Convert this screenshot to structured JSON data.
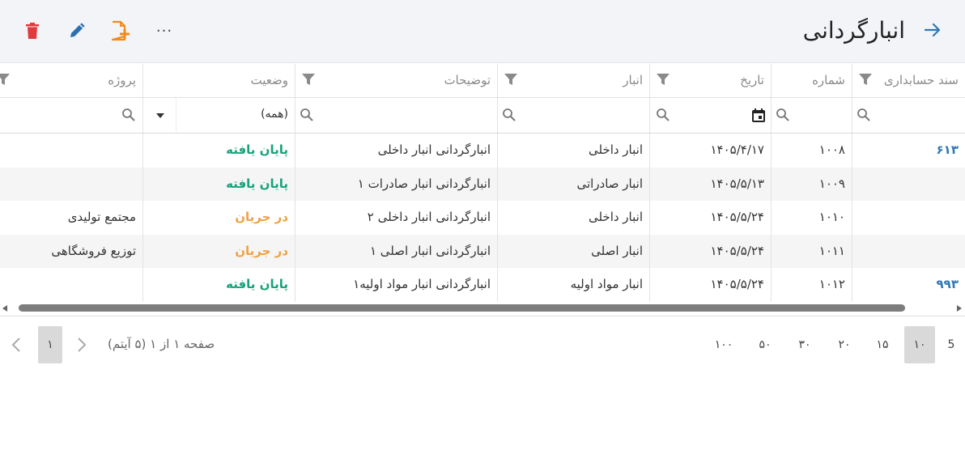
{
  "header": {
    "title": "انبارگردانی",
    "more_label": "···"
  },
  "colors": {
    "accent": "#2f78b8",
    "delete": "#e0393e",
    "edit": "#2a6fb0",
    "add": "#f08c1e",
    "status_done": "#16a37a",
    "status_in_progress": "#f0a143"
  },
  "icons": {
    "back": "arrow-right-icon",
    "delete": "trash-icon",
    "edit": "pencil-icon",
    "add": "add-document-icon",
    "more": "ellipsis-icon",
    "filter": "funnel-icon",
    "search": "magnifier-icon",
    "calendar": "calendar-icon"
  },
  "columns": {
    "doc": "سند حسابداری",
    "num": "شماره",
    "date": "تاریخ",
    "warehouse": "انبار",
    "desc": "توضیحات",
    "status": "وضعیت",
    "project": "پروژه"
  },
  "filters": {
    "status_selected": "(همه)"
  },
  "rows": [
    {
      "doc": "۶۱۳",
      "num": "۱۰۰۸",
      "date": "۱۴۰۵/۴/۱۷",
      "warehouse": "انبار داخلی",
      "desc": "انبارگردانی انبار داخلی",
      "status": "پایان یافته",
      "project": ""
    },
    {
      "doc": "",
      "num": "۱۰۰۹",
      "date": "۱۴۰۵/۵/۱۳",
      "warehouse": "انبار صادراتی",
      "desc": "انبارگردانی انبار صادرات ۱",
      "status": "پایان یافته",
      "project": ""
    },
    {
      "doc": "",
      "num": "۱۰۱۰",
      "date": "۱۴۰۵/۵/۲۴",
      "warehouse": "انبار داخلی",
      "desc": "انبارگردانی انبار داخلی ۲",
      "status": "در جریان",
      "project": "مجتمع تولیدی"
    },
    {
      "doc": "",
      "num": "۱۰۱۱",
      "date": "۱۴۰۵/۵/۲۴",
      "warehouse": "انبار اصلی",
      "desc": "انبارگردانی انبار اصلی ۱",
      "status": "در جریان",
      "project": "توزیع فروشگاهی"
    },
    {
      "doc": "۹۹۳",
      "num": "۱۰۱۲",
      "date": "۱۴۰۵/۵/۲۴",
      "warehouse": "انبار مواد اولیه",
      "desc": "انبارگردانی انبار مواد اولیه۱",
      "status": "پایان یافته",
      "project": ""
    }
  ],
  "pager": {
    "sizes": [
      "5",
      "۱۰",
      "۱۵",
      "۲۰",
      "۳۰",
      "۵۰",
      "۱۰۰"
    ],
    "active_size": "۱۰",
    "info": "صفحه ۱ از ۱ (۵ آیتم)",
    "current_page": "۱"
  }
}
